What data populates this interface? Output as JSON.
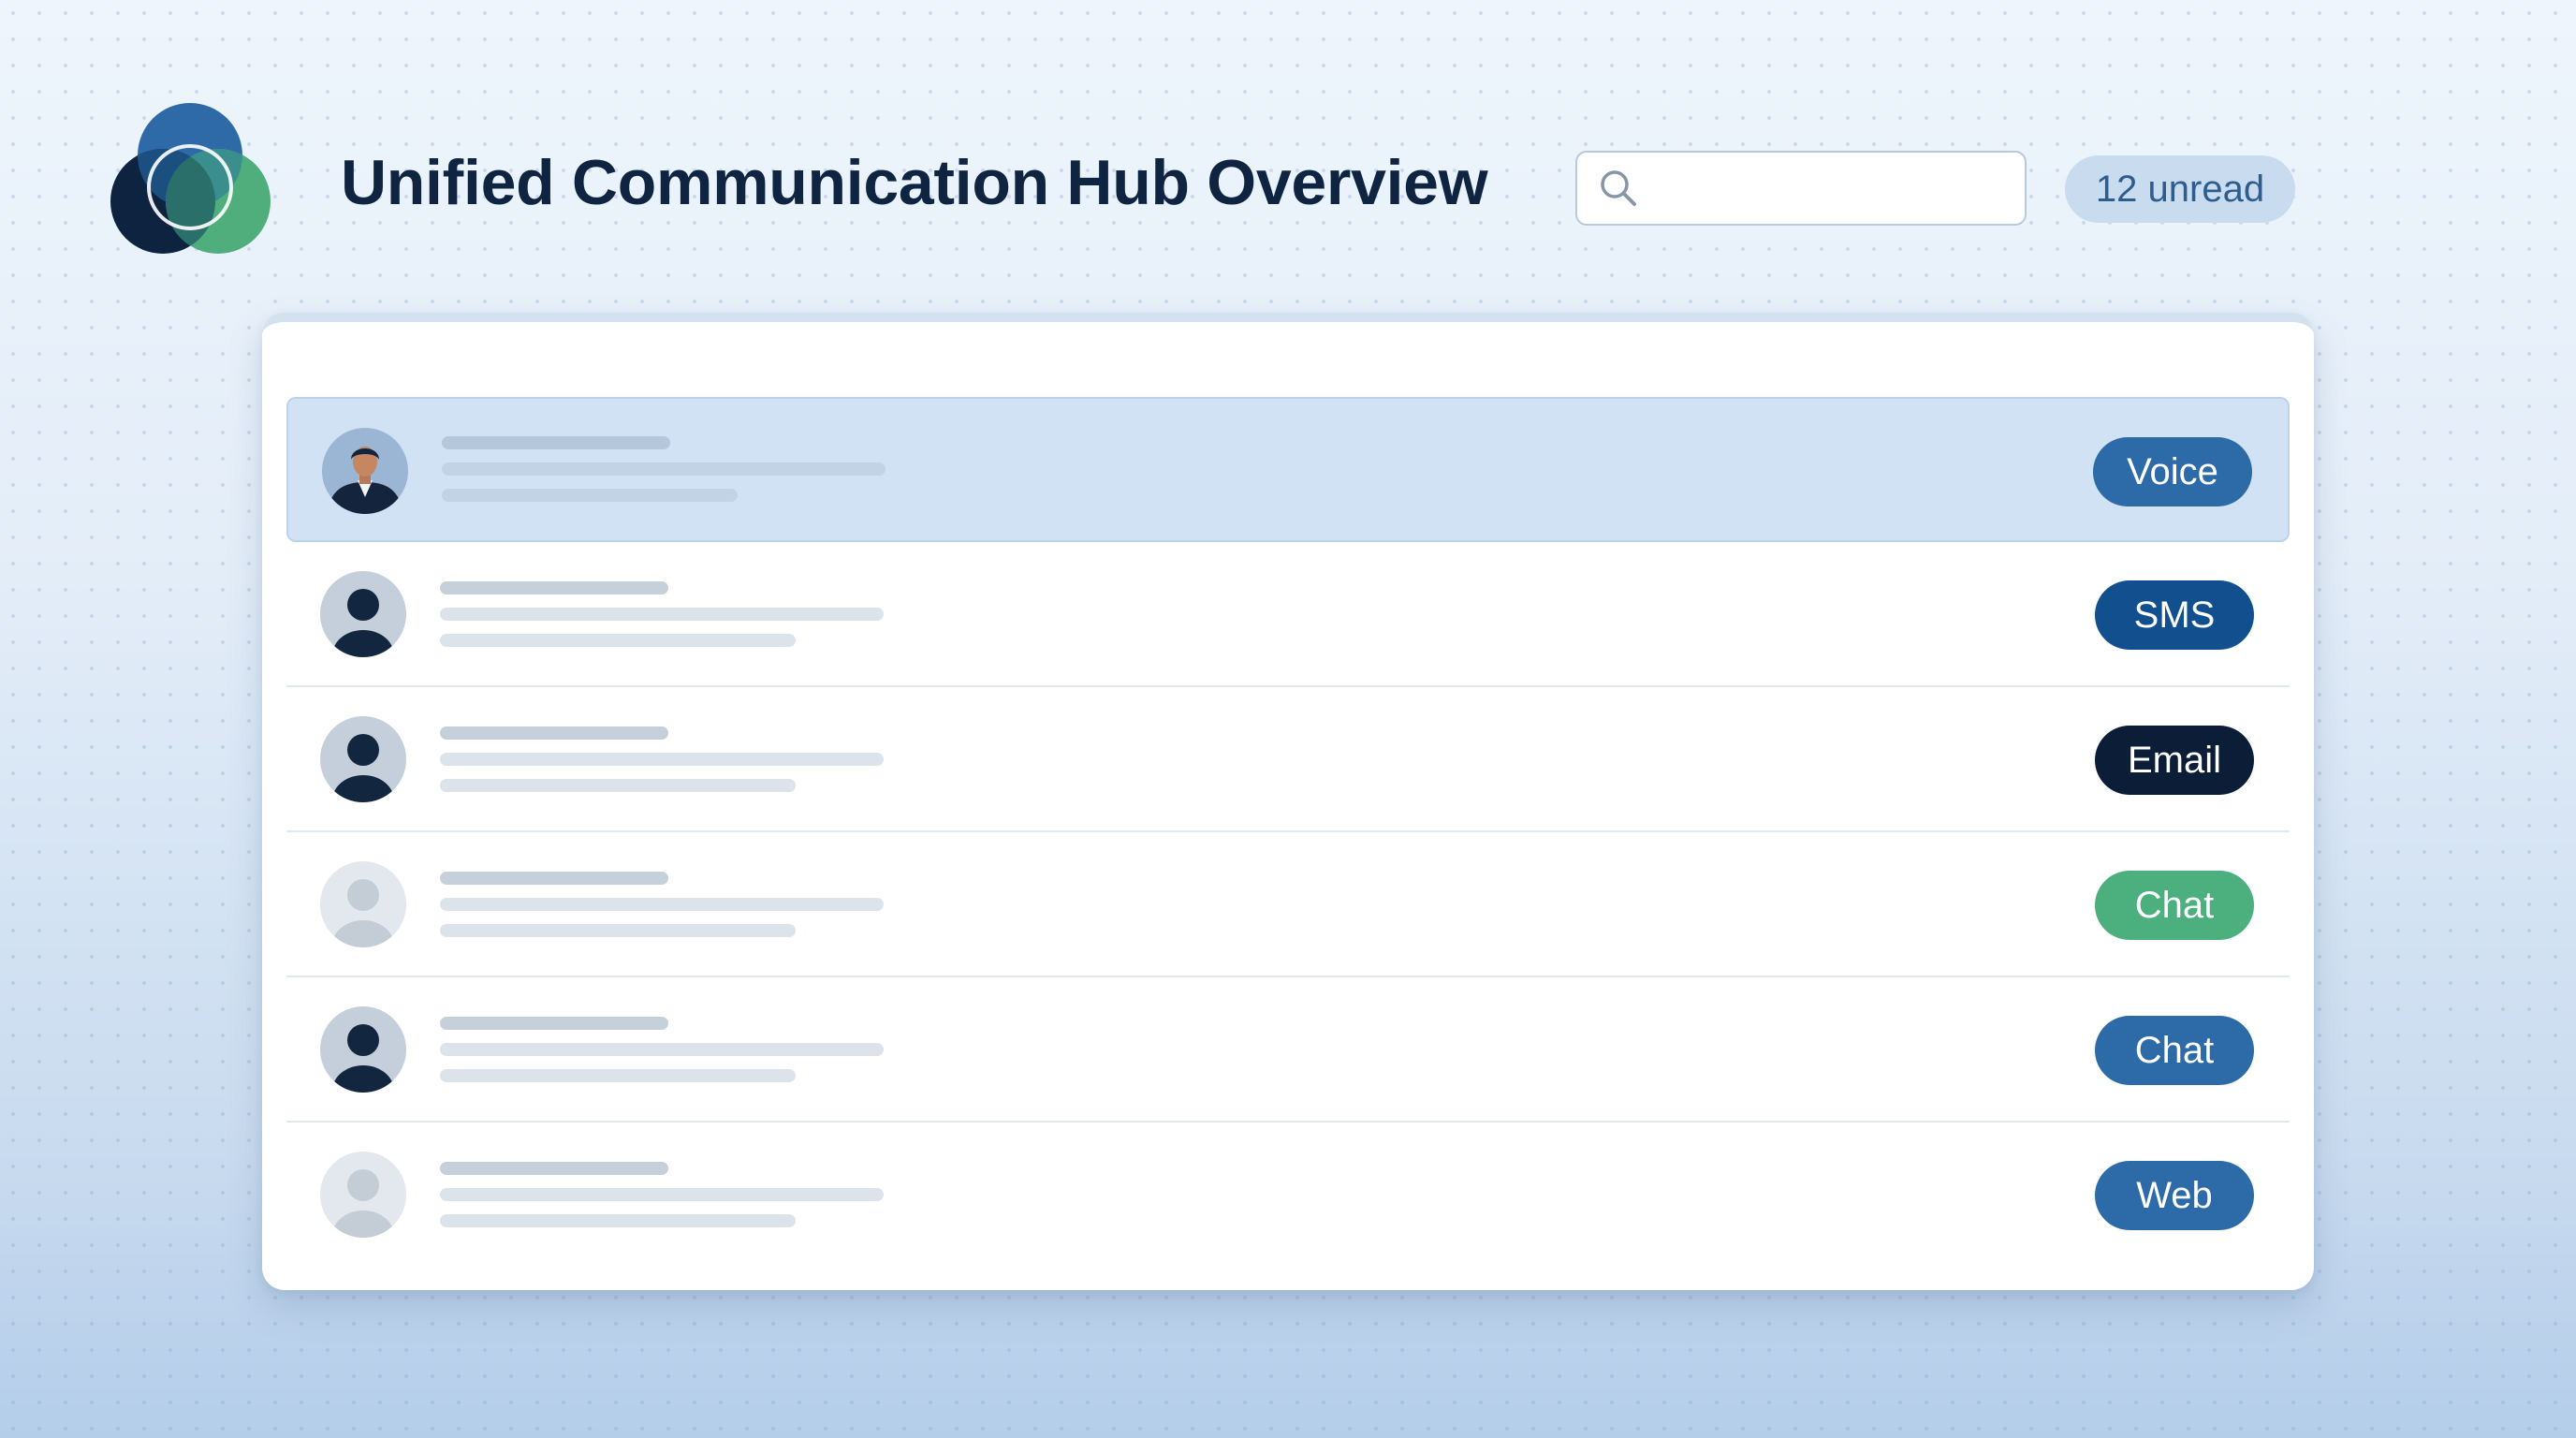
{
  "header": {
    "title": "Unified Communication Hub Overview",
    "logo_icon": "overlapping-circles-logo",
    "search": {
      "icon": "search-icon",
      "value": "",
      "placeholder": ""
    },
    "unread_badge": "12 unread"
  },
  "conversations": [
    {
      "avatar": "person-photo",
      "channel": "Voice",
      "channel_color": "#2c6aa8",
      "selected": true
    },
    {
      "avatar": "person-dark",
      "channel": "SMS",
      "channel_color": "#114f8f",
      "selected": false
    },
    {
      "avatar": "person-dark",
      "channel": "Email",
      "channel_color": "#0c1d38",
      "selected": false
    },
    {
      "avatar": "person-light",
      "channel": "Chat",
      "channel_color": "#4caf7e",
      "selected": false
    },
    {
      "avatar": "person-dark",
      "channel": "Chat",
      "channel_color": "#2c6aa8",
      "selected": false
    },
    {
      "avatar": "person-light",
      "channel": "Web",
      "channel_color": "#2c6aa8",
      "selected": false
    }
  ],
  "colors": {
    "title": "#0f2440",
    "selected_row": "#d1e2f4",
    "badge_bg": "#c9dcef",
    "badge_text": "#2d5d8f"
  }
}
